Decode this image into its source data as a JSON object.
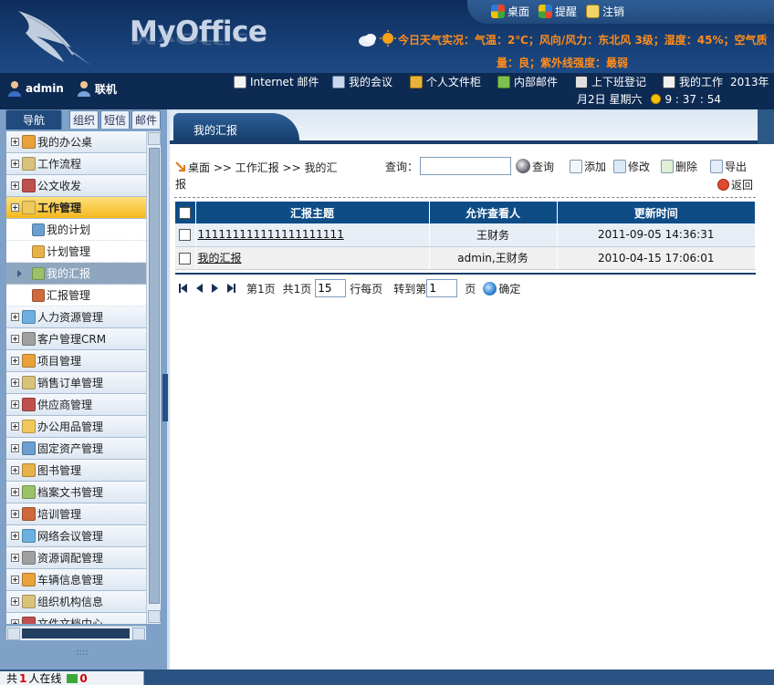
{
  "header": {
    "logo_text": "MyOffice",
    "top_links": [
      {
        "label": "桌面",
        "icon": "windows-flag-icon"
      },
      {
        "label": "提醒",
        "icon": "reminder-icon"
      },
      {
        "label": "注销",
        "icon": "logout-icon"
      }
    ],
    "weather_line1": "今日天气实况：气温：2℃；风向/风力：东北风 3级；湿度：45%；空气质",
    "weather_line2": "量：良；紫外线强度：最弱"
  },
  "toolbar": {
    "username": "admin",
    "status": "联机",
    "quick_links": [
      {
        "label": "Internet 邮件",
        "icon": "internet-mail-icon"
      },
      {
        "label": "我的会议",
        "icon": "meeting-icon"
      },
      {
        "label": "个人文件柜",
        "icon": "file-cabinet-icon"
      },
      {
        "label": "内部邮件",
        "icon": "internal-mail-icon"
      },
      {
        "label": "上下班登记",
        "icon": "attendance-icon"
      },
      {
        "label": "我的工作",
        "icon": "my-work-icon"
      }
    ],
    "year_text": "2013年",
    "date_text": "月2日 星期六",
    "time_text": "9 : 37 : 54"
  },
  "sidebar": {
    "tabs": [
      "导航",
      "组织",
      "短信",
      "邮件"
    ],
    "items": [
      {
        "label": "我的办公桌",
        "kind": "group"
      },
      {
        "label": "工作流程",
        "kind": "group"
      },
      {
        "label": "公文收发",
        "kind": "group"
      },
      {
        "label": "工作管理",
        "kind": "active"
      },
      {
        "label": "我的计划",
        "kind": "child"
      },
      {
        "label": "计划管理",
        "kind": "child"
      },
      {
        "label": "我的汇报",
        "kind": "child-selected"
      },
      {
        "label": "汇报管理",
        "kind": "child"
      },
      {
        "label": "人力资源管理",
        "kind": "group"
      },
      {
        "label": "客户管理CRM",
        "kind": "group"
      },
      {
        "label": "项目管理",
        "kind": "group"
      },
      {
        "label": "销售订单管理",
        "kind": "group"
      },
      {
        "label": "供应商管理",
        "kind": "group"
      },
      {
        "label": "办公用品管理",
        "kind": "group"
      },
      {
        "label": "固定资产管理",
        "kind": "group"
      },
      {
        "label": "图书管理",
        "kind": "group"
      },
      {
        "label": "档案文书管理",
        "kind": "group"
      },
      {
        "label": "培训管理",
        "kind": "group"
      },
      {
        "label": "网络会议管理",
        "kind": "group"
      },
      {
        "label": "资源调配管理",
        "kind": "group"
      },
      {
        "label": "车辆信息管理",
        "kind": "group"
      },
      {
        "label": "组织机构信息",
        "kind": "group"
      },
      {
        "label": "文件文档中心",
        "kind": "group"
      }
    ],
    "grip": "::::"
  },
  "main": {
    "tab_label": "我的汇报",
    "breadcrumb": "桌面 >> 工作汇报 >> 我的汇报",
    "search_label": "查询：",
    "search_value": "",
    "search_button": "查询",
    "actions": {
      "add": "添加",
      "edit": "修改",
      "delete": "删除",
      "export": "导出",
      "back": "返回"
    },
    "table": {
      "headers": [
        "汇报主题",
        "允许查看人",
        "更新时间"
      ],
      "rows": [
        {
          "title": "111111111111111111111",
          "viewers": "王财务",
          "updated": "2011-09-05 14:36:31"
        },
        {
          "title": "我的汇报",
          "viewers": "admin,王财务",
          "updated": "2010-04-15 17:06:01"
        }
      ]
    },
    "pager": {
      "page_text": "第1页",
      "total_text": "共1页",
      "per_page_value": "15",
      "per_page_label": "行每页",
      "goto_label": "转到第",
      "goto_value": "1",
      "page_suffix": "页",
      "confirm_label": "确定"
    }
  },
  "statusbar": {
    "prefix": "共",
    "count": "1",
    "suffix": "人在线",
    "online_count": "0"
  }
}
